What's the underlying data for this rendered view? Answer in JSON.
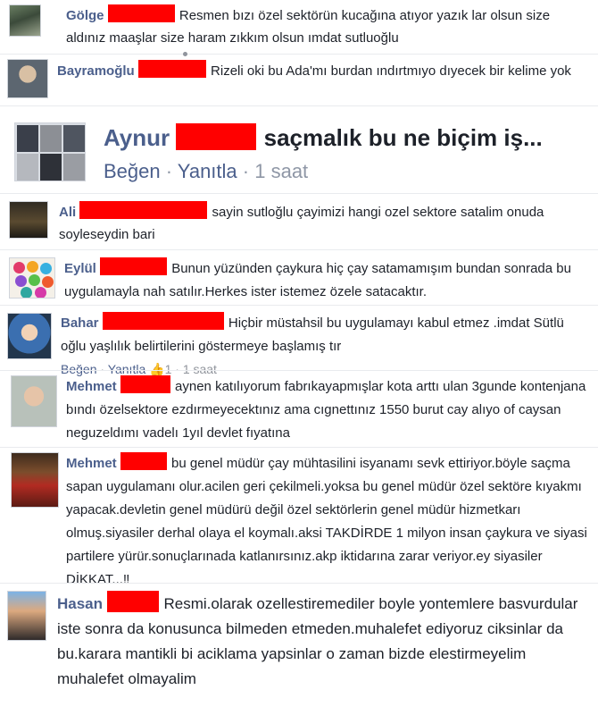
{
  "comments": [
    {
      "author": "Gölge",
      "redaction_width": 75,
      "text": "Resmen bızı özel sektörün kucağına atıyor yazık lar olsun size aldınız maaşlar size haram zıkkım olsun ımdat sutluoğlu"
    },
    {
      "author": "Bayramoğlu",
      "redaction_width": 76,
      "text": "Rizeli oki bu Ada'mı burdan ındırtmıyo dıyecek bir kelime yok"
    },
    {
      "author": "Aynur",
      "redaction_width": 90,
      "text": "saçmalık bu ne biçim iş...",
      "meta": {
        "like": "Beğen",
        "reply": "Yanıtla",
        "separator": "·",
        "time": "1 saat"
      }
    },
    {
      "author": "Ali",
      "redaction_width": 143,
      "text": "sayin sutloğlu çayimizi hangi ozel sektore satalim onuda soyleseydin bari"
    },
    {
      "author": "Eylül",
      "redaction_width": 75,
      "text": "Bunun yüzünden çaykura hiç çay satamamışım bundan sonrada bu uygulamayla nah satılır.Herkes ister istemez özele satacaktır."
    },
    {
      "author": "Bahar",
      "redaction_width": 136,
      "text": "Hiçbir müstahsil bu uygulamayı kabul etmez .imdat Sütlü oğlu yaşlılık belirtilerini göstermeye başlamış tır",
      "meta": {
        "like": "Beğen",
        "reply": "Yanıtla",
        "separator": "·",
        "likes_count": "1",
        "time": "1 saat"
      }
    },
    {
      "author": "Mehmet",
      "redaction_width": 56,
      "text": "aynen katılıyorum fabrıkayapmışlar kota arttı ulan 3gunde kontenjana bındı özelsektore ezdırmeyecektınız ama cıgnettınız 1550 burut cay alıyo of caysan neguzeldımı vadelı 1yıl devlet fıyatına"
    },
    {
      "author": "Mehmet",
      "redaction_width": 52,
      "text": "bu genel müdür çay mühtasilini isyanamı sevk ettiriyor.böyle saçma sapan uygulamanı olur.acilen geri çekilmeli.yoksa bu genel müdür özel sektöre kıyakmı yapacak.devletin genel müdürü değil özel sektörlerin genel müdür hizmetkarı olmuş.siyasiler derhal olaya el koymalı.aksi TAKDİRDE 1 milyon insan çaykura ve siyasi partilere yürür.sonuçlarınada katlanırsınız.akp iktidarına zarar veriyor.ey siyasiler DİKKAT...‼"
    },
    {
      "author": "Hasan",
      "redaction_width": 58,
      "text": "Resmi.olarak ozellestiremediler boyle yontemlere basvurdular iste sonra da konusunca bilmeden etmeden.muhalefet ediyoruz ciksinlar da bu.karara mantikli bi aciklama yapsinlar o zaman bizde elestirmeyelim muhalefet olmayalim"
    }
  ],
  "colors": {
    "redaction": "#ff0000",
    "author": "#4b5f8c",
    "meta": "#8f97a6",
    "text": "#1d2129"
  }
}
